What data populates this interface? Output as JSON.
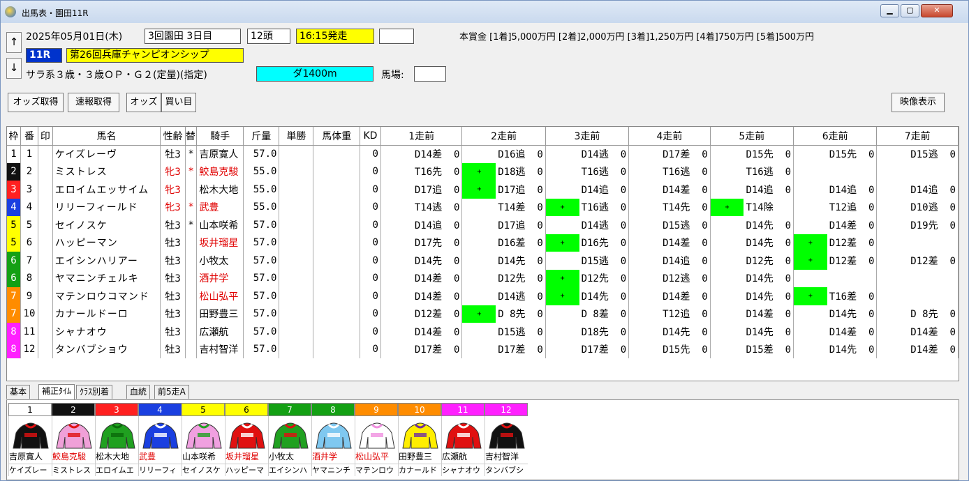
{
  "window": {
    "title": "出馬表・園田11R",
    "min": "▁",
    "max": "▢",
    "close": "✕"
  },
  "header": {
    "date": "2025年05月01日(木)",
    "meeting": "3回園田 3日目",
    "heads": "12頭",
    "post_time": "16:15発走",
    "race_no": "11R",
    "race_name": "第26回兵庫チャンピオンシップ",
    "conditions": "サラ系３歳・３歳ＯＰ・Ｇ２(定量)(指定)",
    "course": "ダ1400m",
    "track_label": "馬場:",
    "prize": "本賞金 [1着]5,000万円 [2着]2,000万円 [3着]1,250万円 [4着]750万円 [5着]500万円",
    "up": "↑",
    "down": "↓"
  },
  "toolbar": {
    "odds_fetch": "オッズ取得",
    "flash_fetch": "速報取得",
    "odds": "オッズ",
    "buy": "買い目",
    "video": "映像表示"
  },
  "columns": [
    "枠",
    "番",
    "印",
    "馬名",
    "性齢",
    "替",
    "騎手",
    "斤量",
    "単勝",
    "馬体重",
    "KD",
    "1走前",
    "2走前",
    "3走前",
    "4走前",
    "5走前",
    "6走前",
    "7走前"
  ],
  "colors": {
    "1": "#ffffff",
    "2": "#111111",
    "3": "#ff2020",
    "4": "#1a3fe0",
    "5": "#ffff00",
    "6": "#14a014",
    "7": "#ff8c00",
    "8": "#ff20ff",
    "plus": "#00ff00"
  },
  "rows": [
    {
      "waku": "1",
      "ban": "1",
      "name": "ケイズレーヴ",
      "sex": "牡3",
      "kae": "*",
      "jockey": "吉原寛人",
      "kin": "57.0",
      "kd": "0",
      "runs": [
        "D14差  0",
        "D16追  0",
        "D14逃  0",
        "D17差  0",
        "D15先  0",
        "D15先  0",
        "D15逃  0"
      ],
      "plus": [
        false,
        false,
        false,
        false,
        false,
        false,
        false
      ]
    },
    {
      "waku": "2",
      "ban": "2",
      "name": "ミストレス",
      "sex": "牝3",
      "kae": "*",
      "jockey": "鮫島克駿",
      "kin": "55.0",
      "kd": "0",
      "red_sex": true,
      "red_jk": true,
      "runs": [
        "T16先  0",
        "D18逃  0",
        "T16逃  0",
        "T16逃  0",
        "T16逃  0",
        "",
        ""
      ],
      "plus": [
        false,
        true,
        false,
        false,
        false,
        false,
        false
      ]
    },
    {
      "waku": "3",
      "ban": "3",
      "name": "エロイムエッサイム",
      "sex": "牝3",
      "kae": "",
      "jockey": "松木大地",
      "kin": "55.0",
      "kd": "0",
      "red_sex": true,
      "runs": [
        "D17追  0",
        "D17追  0",
        "D14追  0",
        "D14差  0",
        "D14追  0",
        "D14追  0",
        "D14追  0"
      ],
      "plus": [
        false,
        true,
        false,
        false,
        false,
        false,
        false
      ]
    },
    {
      "waku": "4",
      "ban": "4",
      "name": "リリーフィールド",
      "sex": "牝3",
      "kae": "*",
      "jockey": "武豊",
      "kin": "55.0",
      "kd": "0",
      "red_sex": true,
      "red_jk": true,
      "runs": [
        "T14逃  0",
        "T14差  0",
        "T16逃  0",
        "T14先  0",
        "T14除",
        "T12追  0",
        "D10逃  0"
      ],
      "plus": [
        false,
        false,
        true,
        false,
        true,
        false,
        false
      ]
    },
    {
      "waku": "5",
      "ban": "5",
      "name": "セイノスケ",
      "sex": "牡3",
      "kae": "*",
      "jockey": "山本咲希",
      "kin": "57.0",
      "kd": "0",
      "runs": [
        "D14追  0",
        "D17追  0",
        "D14逃  0",
        "D15逃  0",
        "D14先  0",
        "D14差  0",
        "D19先  0"
      ],
      "plus": [
        false,
        false,
        false,
        false,
        false,
        false,
        false
      ]
    },
    {
      "waku": "5",
      "ban": "6",
      "name": "ハッピーマン",
      "sex": "牡3",
      "kae": "",
      "jockey": "坂井瑠星",
      "kin": "57.0",
      "kd": "0",
      "red_jk": true,
      "runs": [
        "D17先  0",
        "D16差  0",
        "D16先  0",
        "D14差  0",
        "D14先  0",
        "D12差  0",
        ""
      ],
      "plus": [
        false,
        false,
        true,
        false,
        false,
        true,
        false
      ]
    },
    {
      "waku": "6",
      "ban": "7",
      "name": "エイシンハリアー",
      "sex": "牡3",
      "kae": "",
      "jockey": "小牧太",
      "kin": "57.0",
      "kd": "0",
      "runs": [
        "D14先  0",
        "D14先  0",
        "D15逃  0",
        "D14追  0",
        "D12先  0",
        "D12差  0",
        "D12差  0"
      ],
      "plus": [
        false,
        false,
        false,
        false,
        false,
        true,
        false
      ]
    },
    {
      "waku": "6",
      "ban": "8",
      "name": "ヤマニンチェルキ",
      "sex": "牡3",
      "kae": "",
      "jockey": "酒井学",
      "kin": "57.0",
      "kd": "0",
      "red_jk": true,
      "runs": [
        "D14差  0",
        "D12先  0",
        "D12先  0",
        "D12逃  0",
        "D14先  0",
        "",
        ""
      ],
      "plus": [
        false,
        false,
        true,
        false,
        false,
        false,
        false
      ]
    },
    {
      "waku": "7",
      "ban": "9",
      "name": "マテンロウコマンド",
      "sex": "牡3",
      "kae": "",
      "jockey": "松山弘平",
      "kin": "57.0",
      "kd": "0",
      "red_jk": true,
      "runs": [
        "D14差  0",
        "D14逃  0",
        "D14先  0",
        "D14差  0",
        "D14先  0",
        "T16差  0",
        ""
      ],
      "plus": [
        false,
        false,
        true,
        false,
        false,
        true,
        false
      ]
    },
    {
      "waku": "7",
      "ban": "10",
      "name": "カナールドーロ",
      "sex": "牡3",
      "kae": "",
      "jockey": "田野豊三",
      "kin": "57.0",
      "kd": "0",
      "runs": [
        "D12差  0",
        "D 8先  0",
        "D 8差  0",
        "T12追  0",
        "D14差  0",
        "D14先  0",
        "D 8先  0"
      ],
      "plus": [
        false,
        true,
        false,
        false,
        false,
        false,
        false
      ]
    },
    {
      "waku": "8",
      "ban": "11",
      "name": "シャナオウ",
      "sex": "牡3",
      "kae": "",
      "jockey": "広瀬航",
      "kin": "57.0",
      "kd": "0",
      "runs": [
        "D14差  0",
        "D15逃  0",
        "D18先  0",
        "D14先  0",
        "D14先  0",
        "D14差  0",
        "D14差  0"
      ],
      "plus": [
        false,
        false,
        false,
        false,
        false,
        false,
        false
      ]
    },
    {
      "waku": "8",
      "ban": "12",
      "name": "タンバブショウ",
      "sex": "牡3",
      "kae": "",
      "jockey": "吉村智洋",
      "kin": "57.0",
      "kd": "0",
      "runs": [
        "D17差  0",
        "D17差  0",
        "D17差  0",
        "D15先  0",
        "D15差  0",
        "D14先  0",
        "D14差  0"
      ],
      "plus": [
        false,
        false,
        false,
        false,
        false,
        false,
        false
      ]
    }
  ],
  "tabs": [
    "基本",
    "補正ﾀｲﾑ",
    "ｸﾗｽ別着",
    "血統",
    "前5走A"
  ],
  "silks": [
    {
      "num": "1",
      "jockey": "吉原寛人",
      "horse": "ケイズレー",
      "c1": "#111",
      "c2": "#e01010",
      "red": false
    },
    {
      "num": "2",
      "jockey": "鮫島克駿",
      "horse": "ミストレス",
      "c1": "#f0a0d8",
      "c2": "#e01010",
      "red": true
    },
    {
      "num": "3",
      "jockey": "松木大地",
      "horse": "エロイムエ",
      "c1": "#20a020",
      "c2": "#0a6a0a",
      "red": false
    },
    {
      "num": "4",
      "jockey": "武豊",
      "horse": "リリーフィ",
      "c1": "#1a3fe0",
      "c2": "#ffffff",
      "red": true
    },
    {
      "num": "5",
      "jockey": "山本咲希",
      "horse": "セイノスケ",
      "c1": "#f0a0e0",
      "c2": "#20a020",
      "red": false
    },
    {
      "num": "6",
      "jockey": "坂井瑠星",
      "horse": "ハッピーマ",
      "c1": "#e01010",
      "c2": "#ffffff",
      "red": true
    },
    {
      "num": "7",
      "jockey": "小牧太",
      "horse": "エイシンハ",
      "c1": "#20a020",
      "c2": "#e01010",
      "red": false
    },
    {
      "num": "8",
      "jockey": "酒井学",
      "horse": "ヤマニンチ",
      "c1": "#7fc8f0",
      "c2": "#ffffff",
      "red": true
    },
    {
      "num": "9",
      "jockey": "松山弘平",
      "horse": "マテンロウ",
      "c1": "#ffffff",
      "c2": "#f090e0",
      "red": true
    },
    {
      "num": "10",
      "jockey": "田野豊三",
      "horse": "カナールド",
      "c1": "#ffee00",
      "c2": "#7030a0",
      "red": false
    },
    {
      "num": "11",
      "jockey": "広瀬航",
      "horse": "シャナオウ",
      "c1": "#e01010",
      "c2": "#ffffff",
      "red": false
    },
    {
      "num": "12",
      "jockey": "吉村智洋",
      "horse": "タンバブシ",
      "c1": "#111111",
      "c2": "#e01010",
      "red": false
    }
  ]
}
